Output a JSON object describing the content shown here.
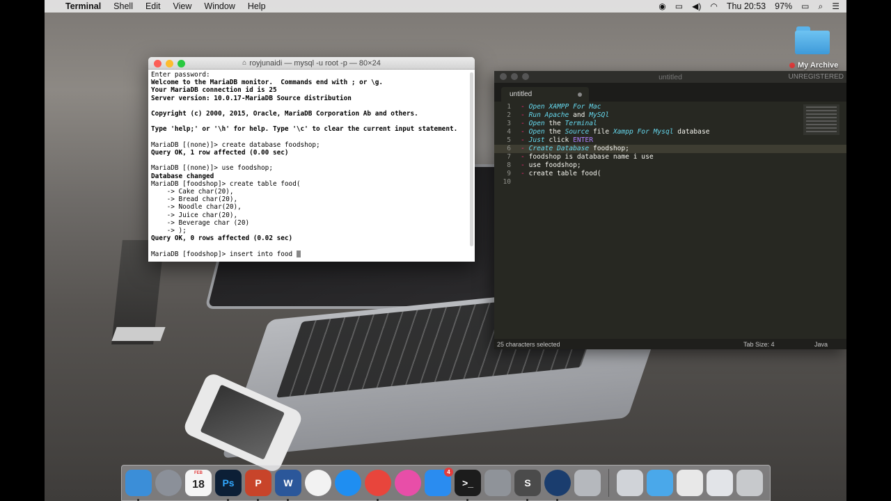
{
  "menubar": {
    "app_name": "Terminal",
    "items": [
      "Shell",
      "Edit",
      "View",
      "Window",
      "Help"
    ],
    "clock": "Thu 20:53",
    "battery": "97%"
  },
  "desktop": {
    "folder_label": "My Archive"
  },
  "terminal": {
    "title": "royjunaidi — mysql -u root -p — 80×24",
    "lines": [
      {
        "t": "Enter password:",
        "b": false
      },
      {
        "t": "Welcome to the MariaDB monitor.  Commands end with ; or \\g.",
        "b": true
      },
      {
        "t": "Your MariaDB connection id is 25",
        "b": true
      },
      {
        "t": "Server version: 10.0.17-MariaDB Source distribution",
        "b": true
      },
      {
        "t": "",
        "b": false
      },
      {
        "t": "Copyright (c) 2000, 2015, Oracle, MariaDB Corporation Ab and others.",
        "b": true
      },
      {
        "t": "",
        "b": false
      },
      {
        "t": "Type 'help;' or '\\h' for help. Type '\\c' to clear the current input statement.",
        "b": true
      },
      {
        "t": "",
        "b": false
      },
      {
        "t": "MariaDB [(none)]> create database foodshop;",
        "b": false
      },
      {
        "t": "Query OK, 1 row affected (0.00 sec)",
        "b": true
      },
      {
        "t": "",
        "b": false
      },
      {
        "t": "MariaDB [(none)]> use foodshop;",
        "b": false
      },
      {
        "t": "Database changed",
        "b": true
      },
      {
        "t": "MariaDB [foodshop]> create table food(",
        "b": false
      },
      {
        "t": "    -> Cake char(20),",
        "b": false
      },
      {
        "t": "    -> Bread char(20),",
        "b": false
      },
      {
        "t": "    -> Noodle char(20),",
        "b": false
      },
      {
        "t": "    -> Juice char(20),",
        "b": false
      },
      {
        "t": "    -> Beverage char (20)",
        "b": false
      },
      {
        "t": "    -> );",
        "b": false
      },
      {
        "t": "Query OK, 0 rows affected (0.02 sec)",
        "b": true
      },
      {
        "t": "",
        "b": false
      }
    ],
    "prompt_line": "MariaDB [foodshop]> insert into food "
  },
  "sublime": {
    "title": "untitled",
    "unregistered": "UNREGISTERED",
    "tab_label": "untitled",
    "code_lines": [
      {
        "n": "1",
        "hl": false,
        "segs": [
          [
            "c-dash",
            "- "
          ],
          [
            "c-kw",
            "Open"
          ],
          [
            "c-plain",
            " "
          ],
          [
            "c-kw",
            "XAMPP For Mac"
          ]
        ]
      },
      {
        "n": "2",
        "hl": false,
        "segs": [
          [
            "c-dash",
            "- "
          ],
          [
            "c-kw",
            "Run Apache"
          ],
          [
            "c-plain",
            " and "
          ],
          [
            "c-kw",
            "MySQl"
          ]
        ]
      },
      {
        "n": "3",
        "hl": false,
        "segs": [
          [
            "c-dash",
            "- "
          ],
          [
            "c-kw",
            "Open"
          ],
          [
            "c-plain",
            " the "
          ],
          [
            "c-kw",
            "Terminal"
          ]
        ]
      },
      {
        "n": "4",
        "hl": false,
        "segs": [
          [
            "c-dash",
            "- "
          ],
          [
            "c-kw",
            "Open"
          ],
          [
            "c-plain",
            " the "
          ],
          [
            "c-kw",
            "Source"
          ],
          [
            "c-plain",
            " file "
          ],
          [
            "c-kw",
            "Xampp For Mysql"
          ],
          [
            "c-plain",
            " database"
          ]
        ]
      },
      {
        "n": "5",
        "hl": false,
        "segs": [
          [
            "c-dash",
            "- "
          ],
          [
            "c-kw",
            "Just"
          ],
          [
            "c-plain",
            " click "
          ],
          [
            "c-str",
            "ENTER"
          ]
        ]
      },
      {
        "n": "6",
        "hl": true,
        "segs": [
          [
            "c-dash",
            "- "
          ],
          [
            "c-kw",
            "Create Database"
          ],
          [
            "c-plain",
            " foodshop;"
          ]
        ]
      },
      {
        "n": "7",
        "hl": false,
        "segs": [
          [
            "c-dash",
            "- "
          ],
          [
            "c-plain",
            "foodshop is database name i use"
          ]
        ]
      },
      {
        "n": "8",
        "hl": false,
        "segs": [
          [
            "c-dash",
            "- "
          ],
          [
            "c-plain",
            "use foodshop;"
          ]
        ]
      },
      {
        "n": "9",
        "hl": false,
        "segs": [
          [
            "c-dash",
            "- "
          ],
          [
            "c-plain",
            "create table food("
          ]
        ]
      },
      {
        "n": "10",
        "hl": false,
        "segs": []
      }
    ],
    "status_selection": "25 characters selected",
    "status_tab_size": "Tab Size: 4",
    "status_syntax": "Java"
  },
  "dock": {
    "calendar_month": "FEB",
    "calendar_day": "18",
    "appstore_badge": "4",
    "apps": [
      {
        "name": "finder",
        "label": "",
        "color": "#3b8ed8"
      },
      {
        "name": "launchpad",
        "label": "",
        "color": "#8b9099"
      },
      {
        "name": "calendar",
        "label": "",
        "color": "#f5f5f5"
      },
      {
        "name": "photoshop",
        "label": "Ps",
        "color": "#0c1f36"
      },
      {
        "name": "powerpoint",
        "label": "P",
        "color": "#c8442a"
      },
      {
        "name": "word",
        "label": "W",
        "color": "#2b579a"
      },
      {
        "name": "photos",
        "label": "",
        "color": "#f2f2f2"
      },
      {
        "name": "safari",
        "label": "",
        "color": "#1f8ef1"
      },
      {
        "name": "chrome",
        "label": "",
        "color": "#e8453c"
      },
      {
        "name": "itunes",
        "label": "",
        "color": "#e84ea8"
      },
      {
        "name": "app-store",
        "label": "",
        "color": "#2a8cf0"
      },
      {
        "name": "terminal",
        "label": ">_",
        "color": "#1c1c1c"
      },
      {
        "name": "system-preferences",
        "label": "",
        "color": "#8f9399"
      },
      {
        "name": "sublime-text",
        "label": "S",
        "color": "#4b4b4b"
      },
      {
        "name": "quicktime",
        "label": "",
        "color": "#1a3d6e"
      },
      {
        "name": "disk-utility",
        "label": "",
        "color": "#b5b8bd"
      }
    ],
    "right": [
      {
        "name": "preview",
        "color": "#d0d3d8"
      },
      {
        "name": "folder",
        "color": "#4aa8ea"
      },
      {
        "name": "document-stack-1",
        "color": "#e8e8e8"
      },
      {
        "name": "document-stack-2",
        "color": "#e2e4e8"
      },
      {
        "name": "trash",
        "color": "#c7c9cc"
      }
    ]
  }
}
